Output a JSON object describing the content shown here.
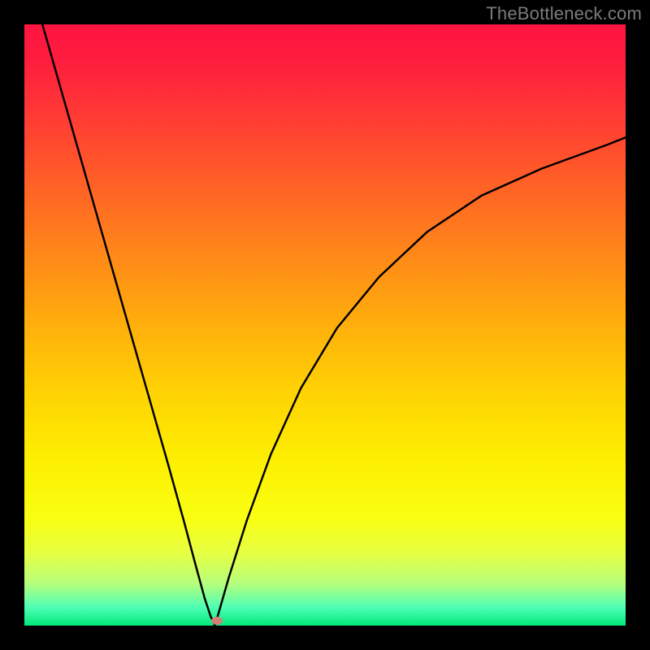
{
  "watermark": "TheBottleneck.com",
  "chart_data": {
    "type": "line",
    "title": "",
    "xlabel": "",
    "ylabel": "",
    "xlim": [
      0,
      1
    ],
    "ylim": [
      0,
      1
    ],
    "grid": false,
    "legend": false,
    "series": [
      {
        "name": "left-branch",
        "x": [
          0.03,
          0.06,
          0.09,
          0.12,
          0.15,
          0.18,
          0.21,
          0.24,
          0.265,
          0.285,
          0.3,
          0.31,
          0.317
        ],
        "y": [
          1.0,
          0.895,
          0.79,
          0.685,
          0.58,
          0.475,
          0.37,
          0.265,
          0.175,
          0.1,
          0.045,
          0.015,
          0.0
        ]
      },
      {
        "name": "right-branch",
        "x": [
          0.317,
          0.34,
          0.37,
          0.41,
          0.46,
          0.52,
          0.59,
          0.67,
          0.76,
          0.86,
          0.97,
          1.0
        ],
        "y": [
          0.0,
          0.08,
          0.175,
          0.285,
          0.395,
          0.495,
          0.58,
          0.655,
          0.715,
          0.76,
          0.8,
          0.812
        ]
      }
    ],
    "marker": {
      "x": 0.32,
      "y": 0.008,
      "color": "#cf8077"
    },
    "background_gradient": {
      "top": "#fe1540",
      "mid": "#ffcf04",
      "bottom": "#02e879"
    }
  }
}
